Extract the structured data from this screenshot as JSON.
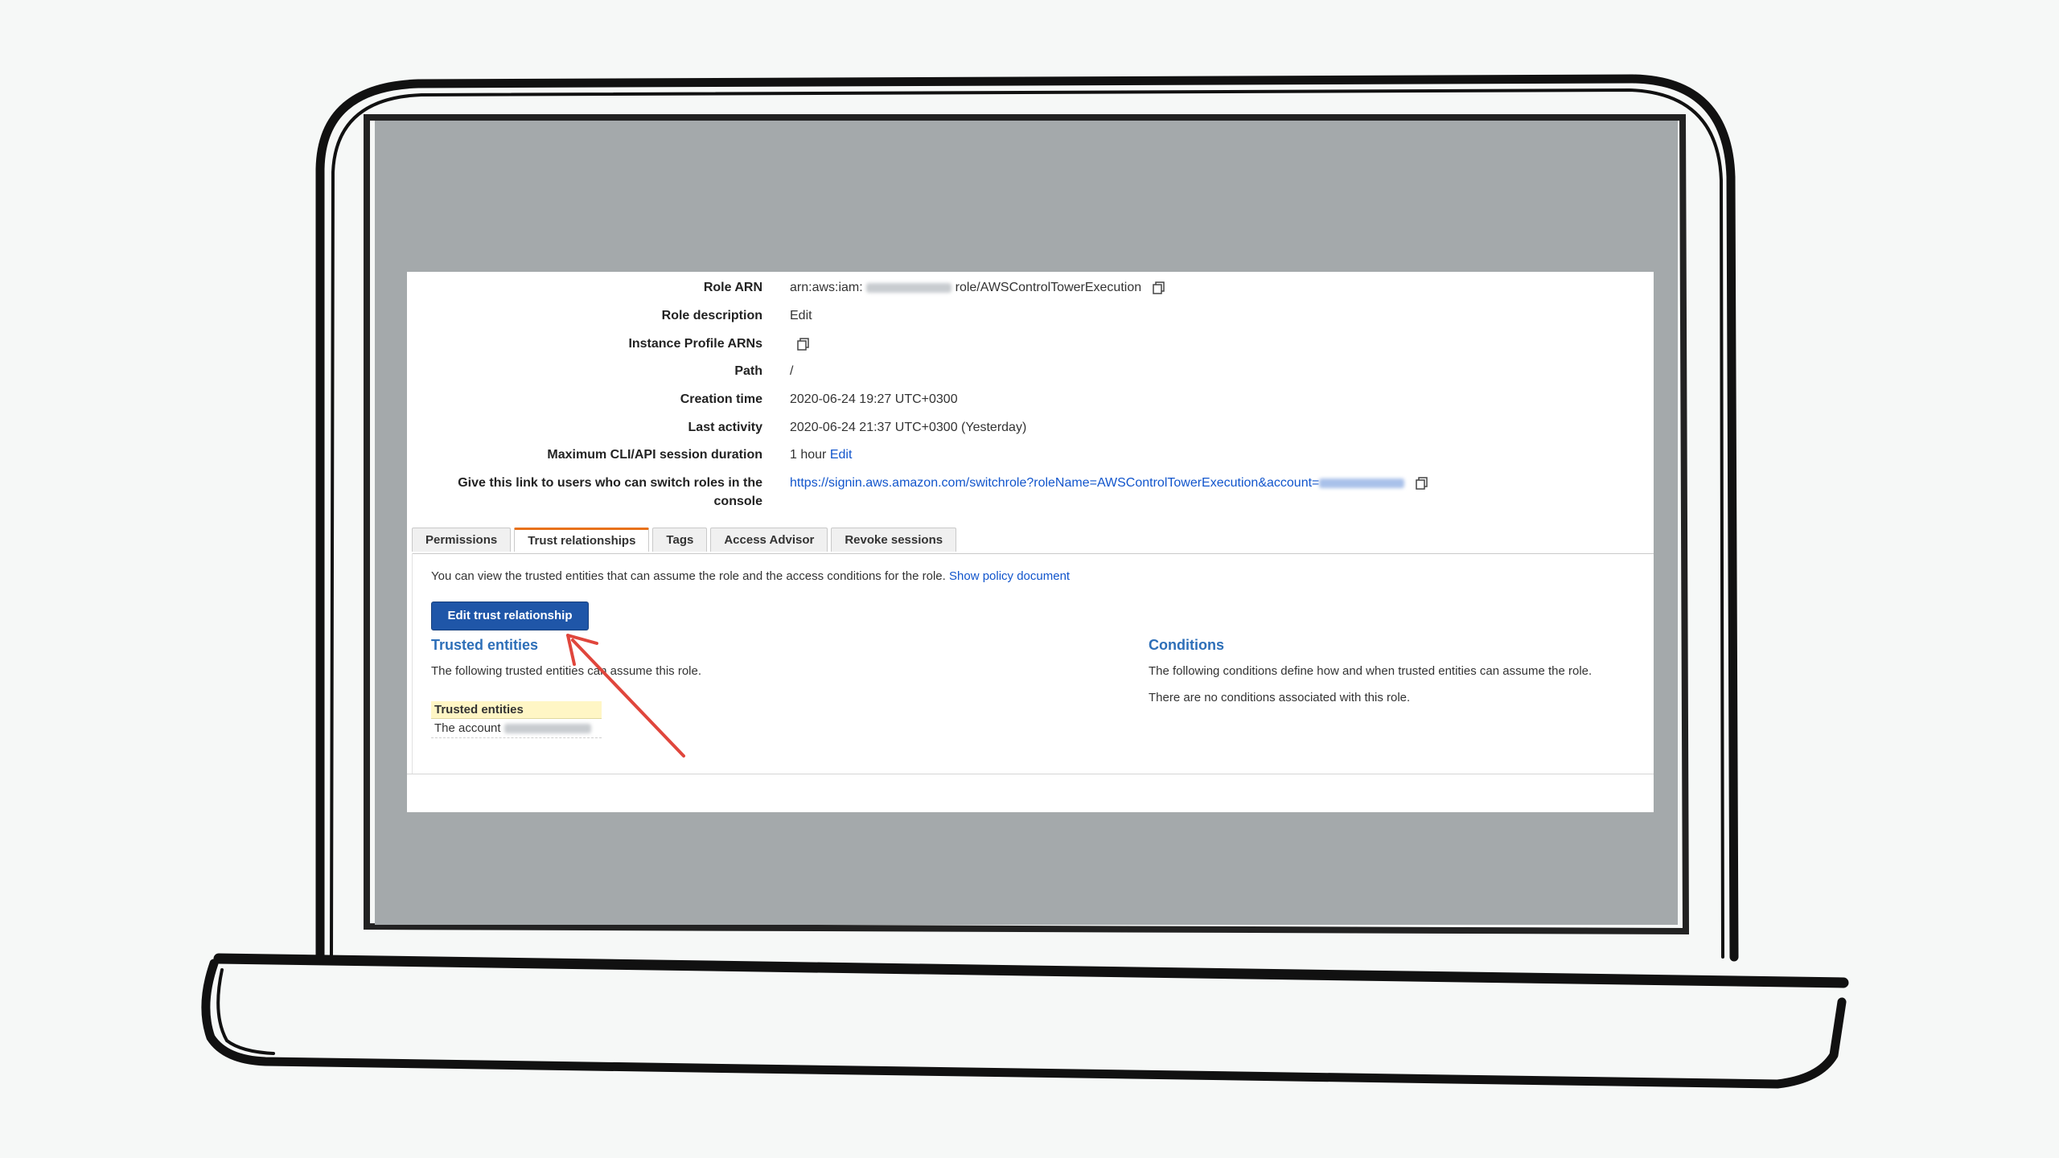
{
  "role_summary": {
    "role_arn_label": "Role ARN",
    "role_arn_prefix": "arn:aws:iam:",
    "role_arn_suffix": "role/AWSControlTowerExecution",
    "role_description_label": "Role description",
    "role_description_link": "Edit",
    "instance_profile_label": "Instance Profile ARNs",
    "path_label": "Path",
    "path_value": "/",
    "creation_time_label": "Creation time",
    "creation_time_value": "2020-06-24 19:27 UTC+0300",
    "last_activity_label": "Last activity",
    "last_activity_value": "2020-06-24 21:37 UTC+0300 (Yesterday)",
    "max_session_label": "Maximum CLI/API session duration",
    "max_session_value": "1 hour",
    "max_session_link": "Edit",
    "switch_link_label_line1": "Give this link to users who can switch roles in the",
    "switch_link_label_line2": "console",
    "switch_link_url": "https://signin.aws.amazon.com/switchrole?roleName=AWSControlTowerExecution&account="
  },
  "tabs": [
    {
      "label": "Permissions",
      "active": false
    },
    {
      "label": "Trust relationships",
      "active": true
    },
    {
      "label": "Tags",
      "active": false
    },
    {
      "label": "Access Advisor",
      "active": false
    },
    {
      "label": "Revoke sessions",
      "active": false
    }
  ],
  "trust": {
    "info_text": "You can view the trusted entities that can assume the role and the access conditions for the role.",
    "info_link": "Show policy document",
    "edit_button": "Edit trust relationship",
    "trusted_title": "Trusted entities",
    "trusted_text": "The following trusted entities can assume this role.",
    "table_header": "Trusted entities",
    "table_row_prefix": "The account",
    "conditions_title": "Conditions",
    "conditions_text": "The following conditions define how and when trusted entities can assume the role.",
    "no_conditions_text": "There are no conditions associated with this role."
  },
  "colors": {
    "accent_tab": "#e8711a",
    "primary_button": "#1f56a8",
    "link": "#1155cc",
    "section_title": "#2d6fb8",
    "annotation_arrow": "#e0463c"
  },
  "icons": [
    "copy-icon",
    "annotation-arrow"
  ]
}
